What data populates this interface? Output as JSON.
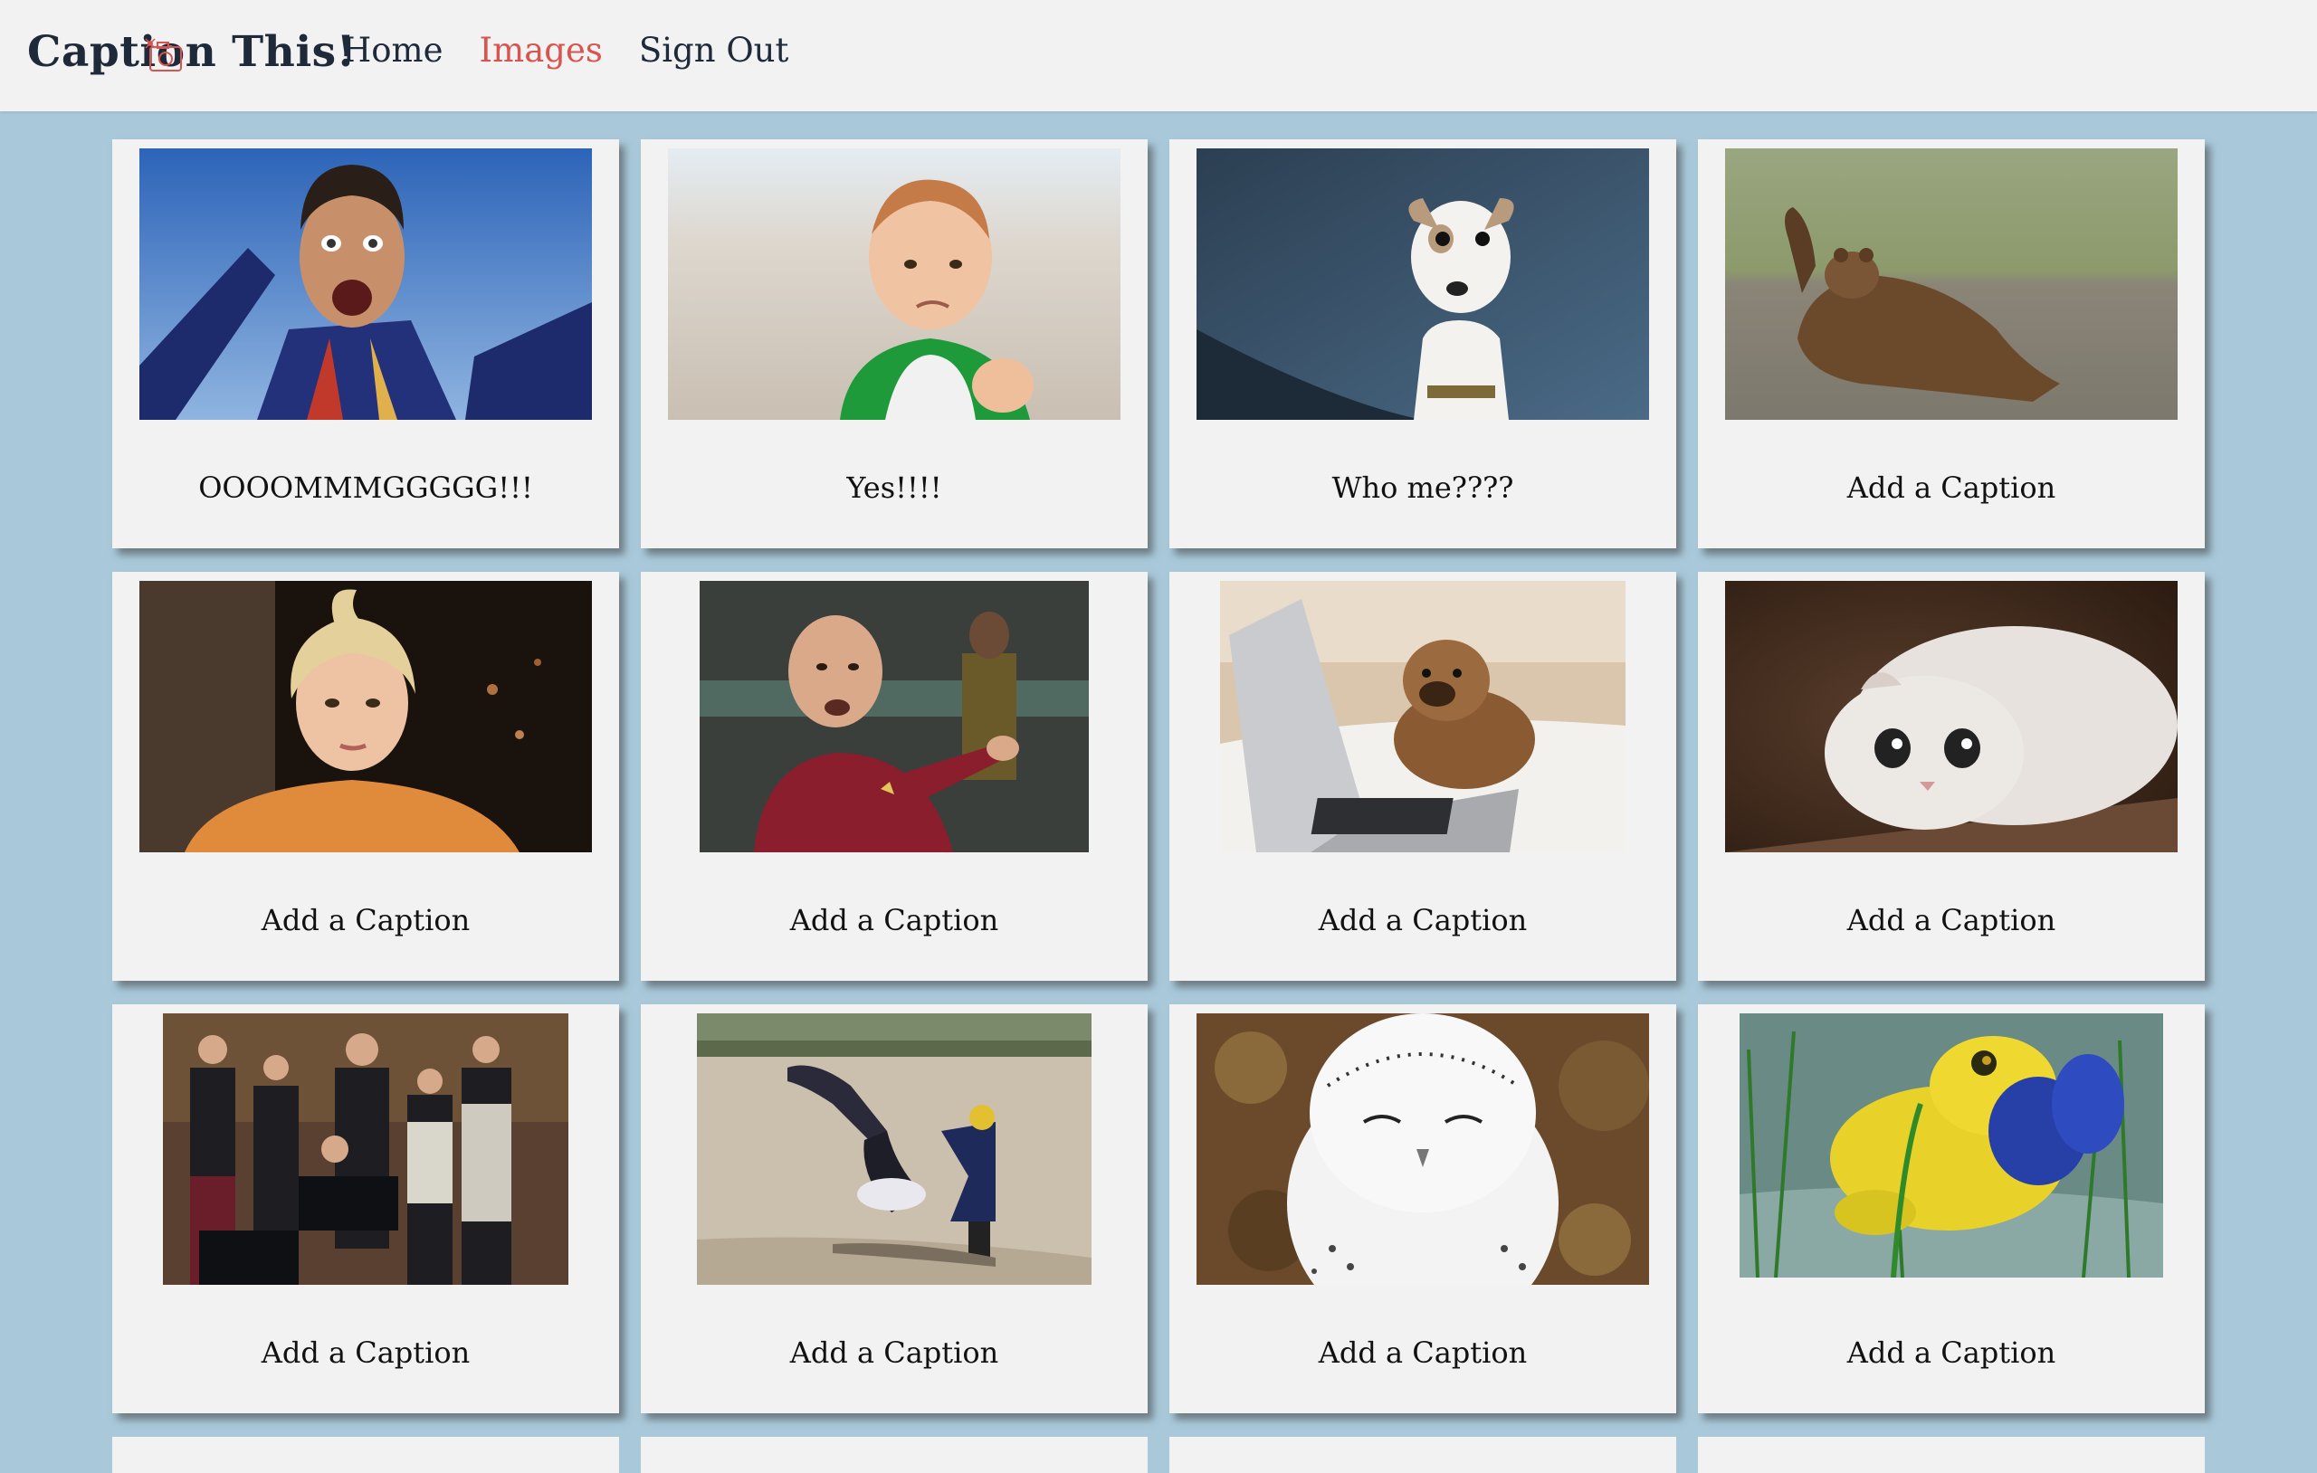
{
  "header": {
    "brand": "Caption This!",
    "nav": [
      {
        "label": "Home",
        "active": false
      },
      {
        "label": "Images",
        "active": true
      },
      {
        "label": "Sign Out",
        "active": false
      }
    ]
  },
  "colors": {
    "background": "#a9c9da",
    "card": "#f2f2f2",
    "active_link": "#d9534f",
    "brand": "#1e2a3a"
  },
  "cards": [
    {
      "image": "man-in-blue-suit-shouting",
      "caption": "OOOOMMMGGGGG!!!"
    },
    {
      "image": "baby-fist-on-beach",
      "caption": "Yes!!!!"
    },
    {
      "image": "surprised-white-dog",
      "caption": "Who me????"
    },
    {
      "image": "bear-cub-waving",
      "caption": "Add a Caption"
    },
    {
      "image": "blonde-woman-messy-hair",
      "caption": "Add a Caption"
    },
    {
      "image": "starship-captain-gesturing",
      "caption": "Add a Caption"
    },
    {
      "image": "puppy-on-laptop",
      "caption": "Add a Caption"
    },
    {
      "image": "flat-white-cat",
      "caption": "Add a Caption"
    },
    {
      "image": "group-at-computers",
      "caption": "Add a Caption"
    },
    {
      "image": "person-falling-playground",
      "caption": "Add a Caption"
    },
    {
      "image": "smiling-snowy-owl",
      "caption": "Add a Caption"
    },
    {
      "image": "yellow-frog-blue-cheeks",
      "caption": "Add a Caption"
    }
  ]
}
